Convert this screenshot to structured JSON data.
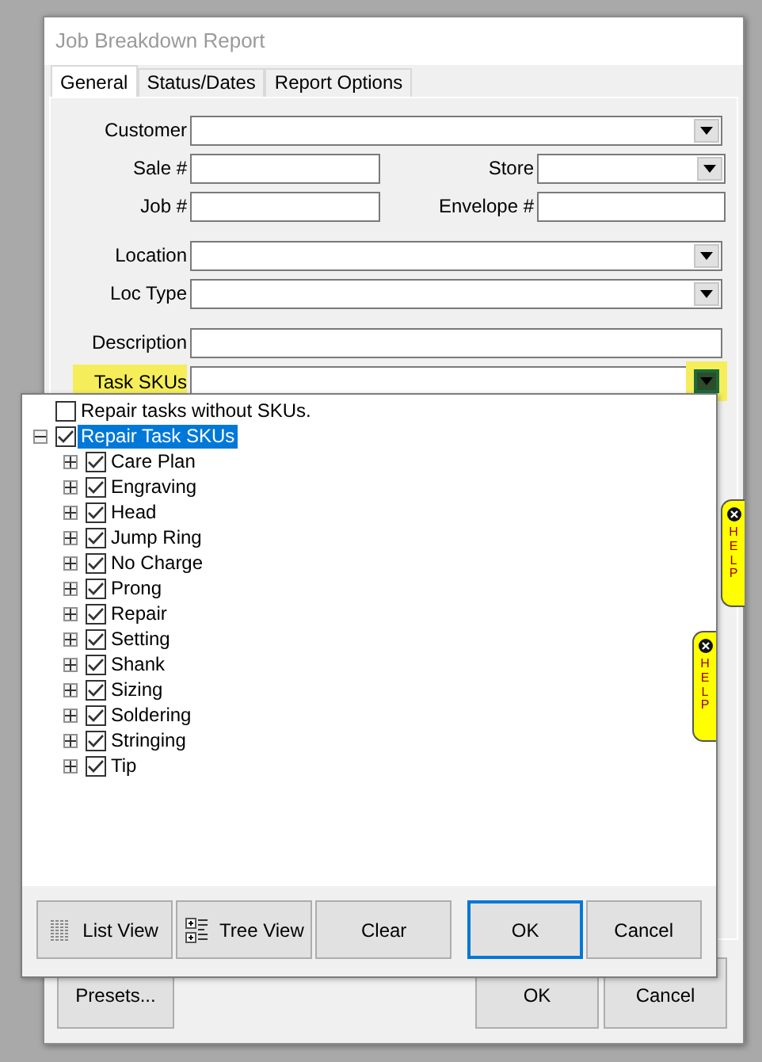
{
  "window": {
    "title": "Job Breakdown Report"
  },
  "tabs": [
    {
      "label": "General",
      "selected": true
    },
    {
      "label": "Status/Dates",
      "selected": false
    },
    {
      "label": "Report Options",
      "selected": false
    }
  ],
  "groups": [
    [
      [
        {
          "label": "Customer",
          "kind": "combo"
        }
      ],
      [
        {
          "label": "Sale #",
          "kind": "text"
        },
        {
          "label": "Store",
          "kind": "combo"
        }
      ],
      [
        {
          "label": "Job #",
          "kind": "text"
        },
        {
          "label": "Envelope #",
          "kind": "text"
        }
      ]
    ],
    [
      [
        {
          "label": "Location",
          "kind": "combo"
        }
      ],
      [
        {
          "label": "Loc Type",
          "kind": "combo"
        }
      ]
    ],
    [
      [
        {
          "label": "Description",
          "kind": "text"
        }
      ],
      [
        {
          "label": "Task SKUs",
          "kind": "combo",
          "highlighted": true
        }
      ]
    ]
  ],
  "buttons": [
    {
      "label": "Presets..."
    },
    {
      "label": "OK"
    },
    {
      "label": "Cancel"
    }
  ],
  "dropdown": {
    "items": [
      {
        "label": "Repair tasks without SKUs.",
        "checked": false,
        "selected": false
      },
      {
        "label": "Repair Task SKUs",
        "checked": true,
        "selected": true,
        "expanded": true,
        "children": [
          {
            "label": "Care Plan",
            "checked": true,
            "selected": false,
            "expanded": false
          },
          {
            "label": "Engraving",
            "checked": true,
            "selected": false,
            "expanded": false
          },
          {
            "label": "Head",
            "checked": true,
            "selected": false,
            "expanded": false
          },
          {
            "label": "Jump Ring",
            "checked": true,
            "selected": false,
            "expanded": false
          },
          {
            "label": "No Charge",
            "checked": true,
            "selected": false,
            "expanded": false
          },
          {
            "label": "Prong",
            "checked": true,
            "selected": false,
            "expanded": false
          },
          {
            "label": "Repair",
            "checked": true,
            "selected": false,
            "expanded": false
          },
          {
            "label": "Setting",
            "checked": true,
            "selected": false,
            "expanded": false
          },
          {
            "label": "Shank",
            "checked": true,
            "selected": false,
            "expanded": false
          },
          {
            "label": "Sizing",
            "checked": true,
            "selected": false,
            "expanded": false
          },
          {
            "label": "Soldering",
            "checked": true,
            "selected": false,
            "expanded": false
          },
          {
            "label": "Stringing",
            "checked": true,
            "selected": false,
            "expanded": false
          },
          {
            "label": "Tip",
            "checked": true,
            "selected": false,
            "expanded": false
          }
        ]
      }
    ],
    "buttons": [
      {
        "label": "List View",
        "kind": "list"
      },
      {
        "label": "Tree View",
        "kind": "tree"
      },
      {
        "label": "Clear",
        "kind": "plain"
      },
      {
        "label": "OK",
        "kind": "plain",
        "default": true
      },
      {
        "label": "Cancel",
        "kind": "plain",
        "default": false
      }
    ]
  },
  "help_tabs": [
    {
      "label": "HELP"
    },
    {
      "label": "HELP"
    }
  ]
}
